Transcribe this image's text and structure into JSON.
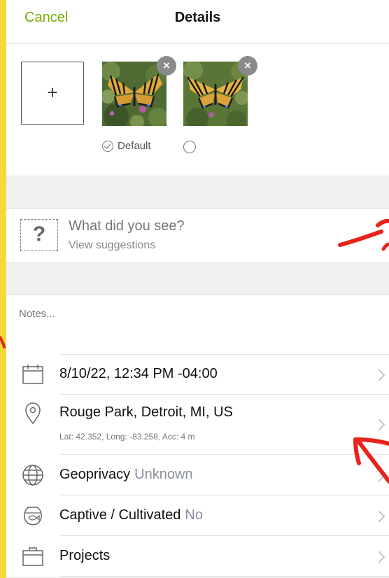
{
  "header": {
    "cancel_label": "Cancel",
    "title": "Details"
  },
  "photos": {
    "add_label": "+",
    "remove_label": "×",
    "default_label": "Default"
  },
  "species": {
    "placeholder_icon": "?",
    "question": "What did you see?",
    "suggestions_label": "View suggestions"
  },
  "notes": {
    "placeholder": "Notes..."
  },
  "details": {
    "date": "8/10/22, 12:34 PM -04:00",
    "location": "Rouge Park, Detroit, MI, US",
    "coords": "Lat: 42.352, Long: -83.258, Acc: 4 m",
    "geoprivacy_label": "Geoprivacy",
    "geoprivacy_value": "Unknown",
    "captive_label": "Captive / Cultivated",
    "captive_value": "No",
    "projects_label": "Projects"
  },
  "icons": {
    "calendar": "calendar-icon",
    "location": "map-pin-icon",
    "geoprivacy": "globe-icon",
    "captive": "fishbowl-icon",
    "projects": "briefcase-icon"
  },
  "colors": {
    "accent": "#74ac00",
    "annotation": "#e8231b",
    "border": "#f5d93a"
  }
}
